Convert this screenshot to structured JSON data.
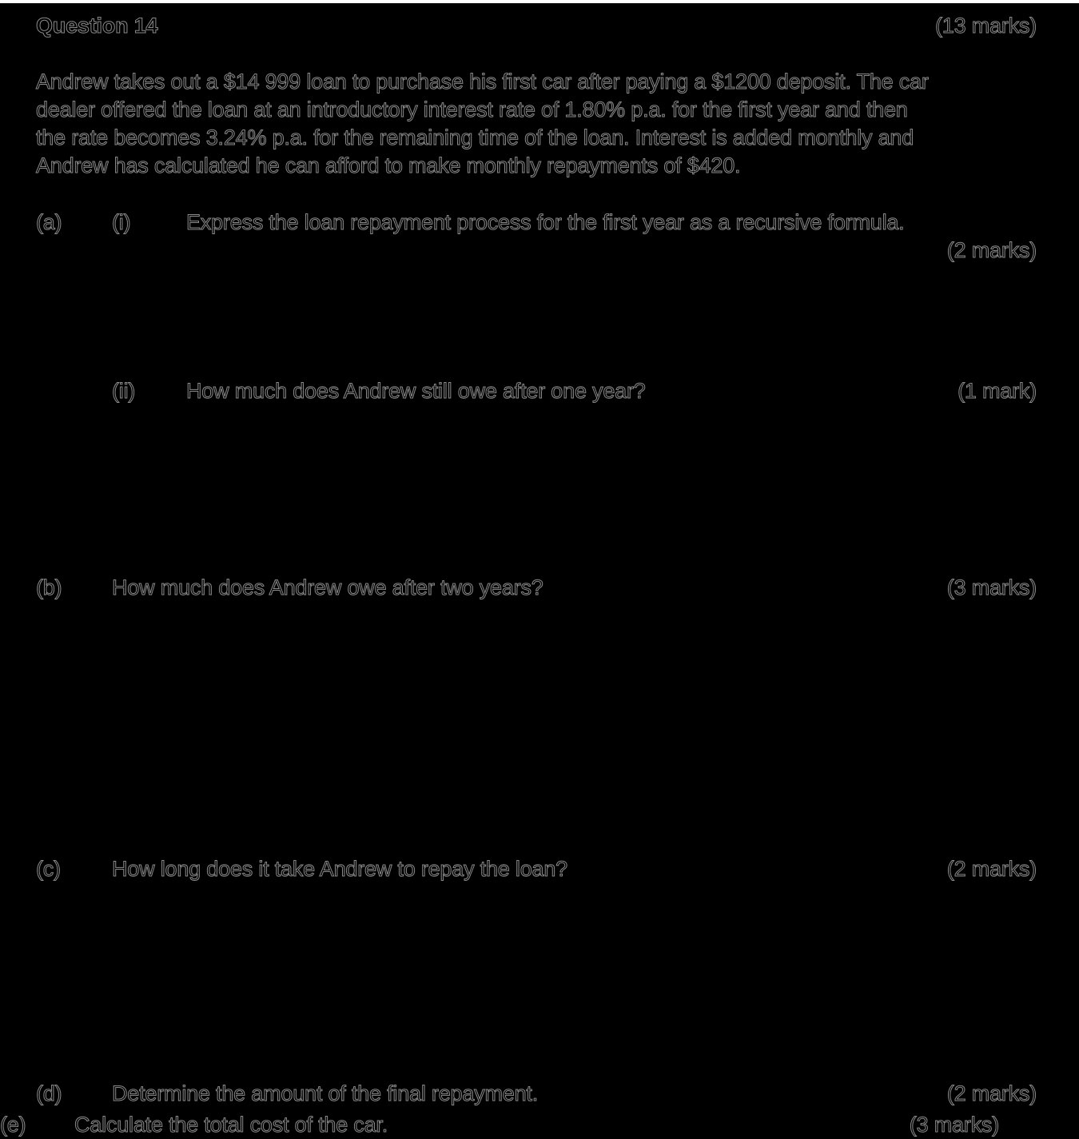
{
  "question": {
    "title": "Question 14",
    "marks": "(13 marks)"
  },
  "stem": {
    "lines": [
      "Andrew takes out a $14 999 loan to purchase his first car after paying a $1200 deposit. The car",
      "dealer offered the loan at an introductory interest rate of 1.80% p.a. for the first year and then",
      "the rate becomes 3.24% p.a. for the remaining time of the loan. Interest is added monthly and",
      "Andrew has calculated he can afford to make monthly repayments of $420."
    ]
  },
  "parts": {
    "a": {
      "label": "(a)",
      "i": {
        "label": "(i)",
        "text": "Express the loan repayment process for the first year as a recursive formula.",
        "marks": "(2 marks)"
      },
      "ii": {
        "label": "(ii)",
        "text": "How much does Andrew still owe after one year?",
        "marks": "(1 mark)"
      }
    },
    "b": {
      "label": "(b)",
      "text": "How much does Andrew owe after two years?",
      "marks": "(3 marks)"
    },
    "c": {
      "label": "(c)",
      "text": "How long does it take Andrew to repay the loan?",
      "marks": "(2 marks)"
    },
    "d": {
      "label": "(d)",
      "text": "Determine the amount of the final repayment.",
      "marks": "(2 marks)"
    },
    "e": {
      "label": "(e)",
      "text": "Calculate the total cost of the car.",
      "marks": "(3 marks)"
    }
  }
}
